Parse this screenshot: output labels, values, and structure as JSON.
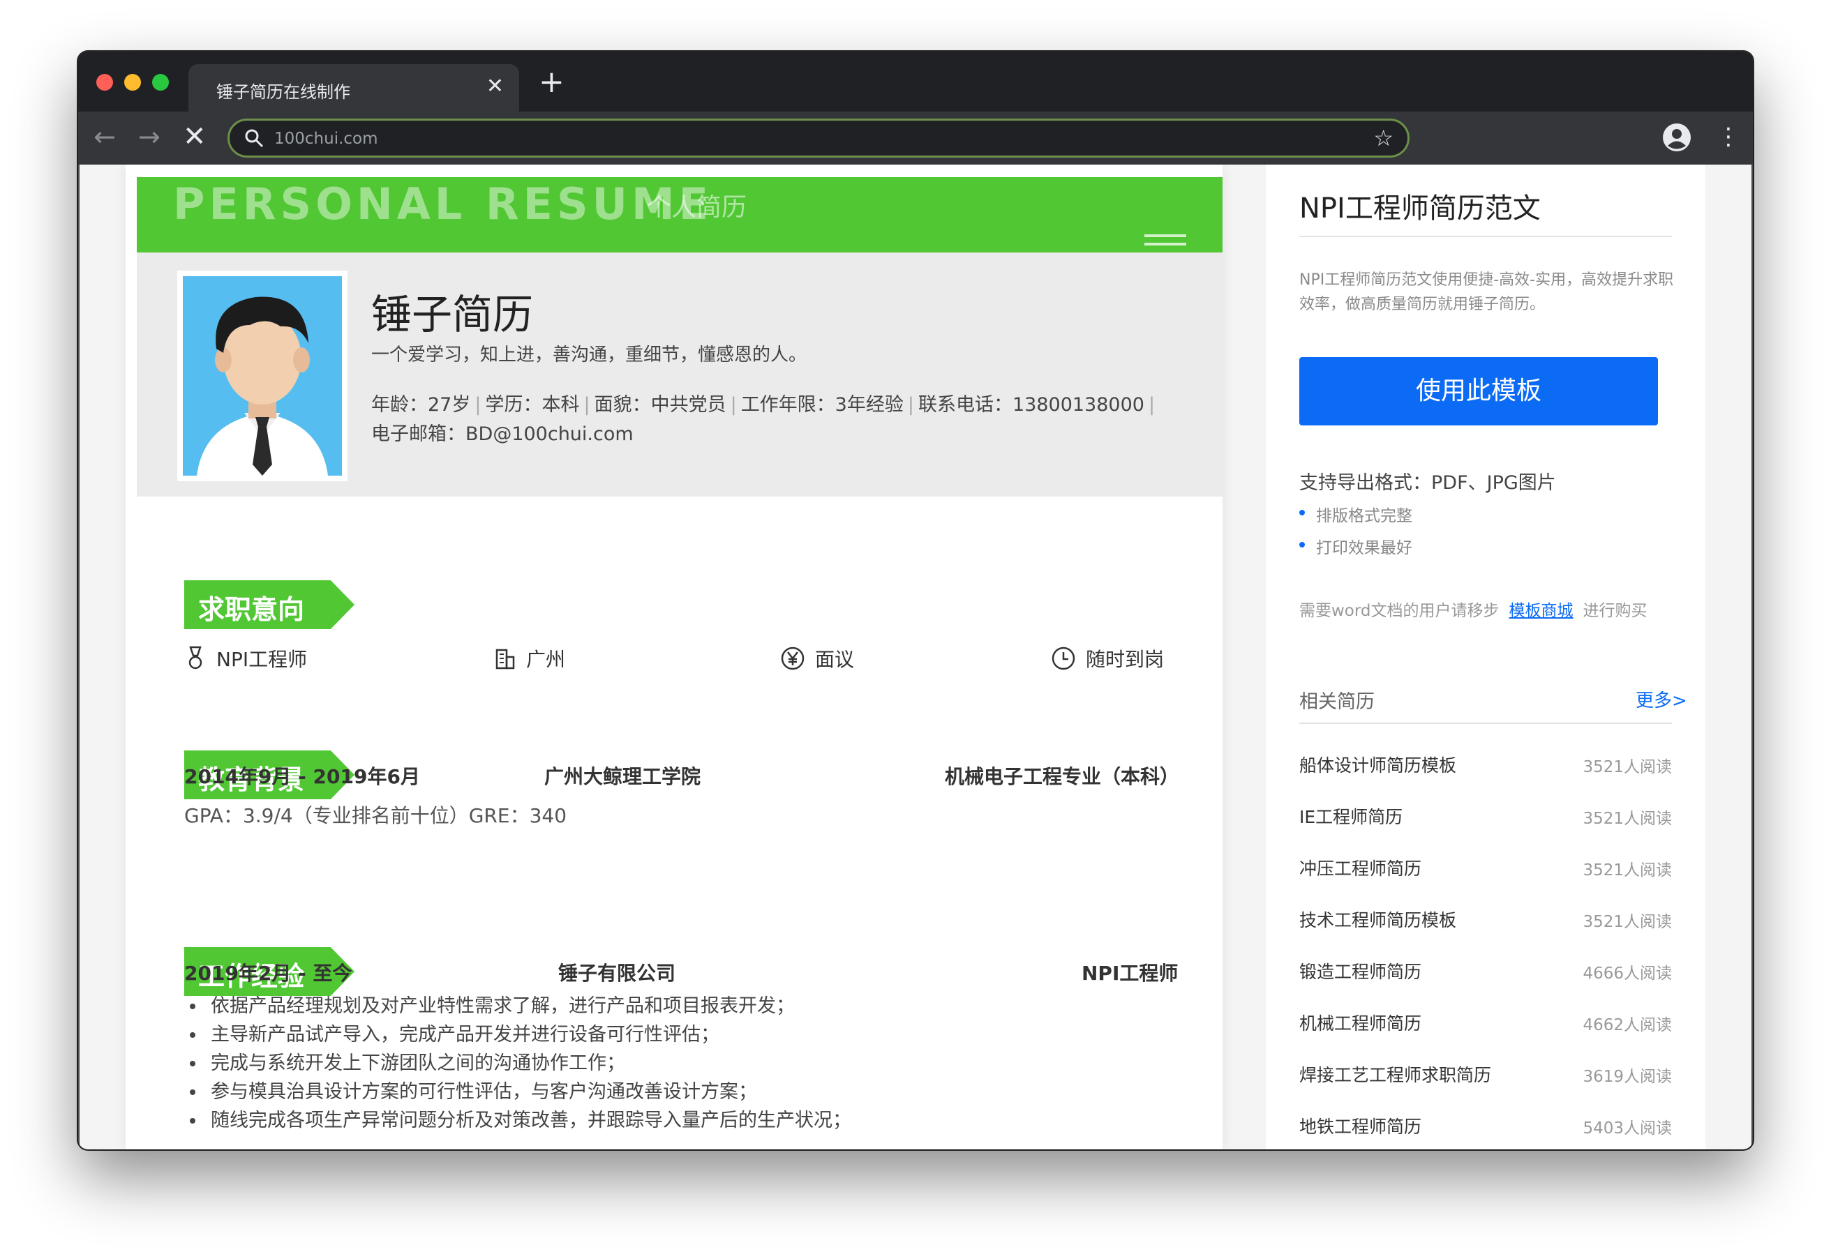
{
  "browser": {
    "tab_title": "锤子简历在线制作",
    "tab_close": "✕",
    "new_tab": "+",
    "url": "100chui.com",
    "back": "←",
    "forward": "→",
    "stop": "✕",
    "star": "☆",
    "menu": "⋮"
  },
  "resume": {
    "banner_title": "PERSONAL RESUME",
    "banner_subtitle": "个人简历",
    "name": "锤子简历",
    "motto": "一个爱学习，知上进，善沟通，重细节，懂感恩的人。",
    "info": {
      "age": "年龄：27岁",
      "education": "学历：本科",
      "politics": "面貌：中共党员",
      "experience": "工作年限：3年经验",
      "phone": "联系电话：13800138000",
      "email": "电子邮箱：BD@100chui.com",
      "separator": "|"
    },
    "sections": {
      "intent": "求职意向",
      "education": "教育背景",
      "work": "工作经验"
    },
    "intent": {
      "position": "NPI工程师",
      "city": "广州",
      "salary": "面议",
      "availability": "随时到岗"
    },
    "education": {
      "period": "2014年9月 - 2019年6月",
      "school": "广州大鲸理工学院",
      "major": "机械电子工程专业（本科）",
      "gpa": "GPA：3.9/4（专业排名前十位）GRE：340"
    },
    "work": {
      "period": "2019年2月 - 至今",
      "company": "锤子有限公司",
      "title": "NPI工程师",
      "bullets": [
        "依据产品经理规划及对产业特性需求了解，进行产品和项目报表开发；",
        "主导新产品试产导入，完成产品开发并进行设备可行性评估；",
        "完成与系统开发上下游团队之间的沟通协作工作；",
        "参与模具治具设计方案的可行性评估，与客户沟通改善设计方案；",
        "随线完成各项生产异常问题分析及对策改善，并跟踪导入量产后的生产状况；"
      ]
    }
  },
  "sidebar": {
    "title": "NPI工程师简历范文",
    "desc": "NPI工程师简历范文使用便捷-高效-实用，高效提升求职效率，做高质量简历就用锤子简历。",
    "use_button": "使用此模板",
    "formats": "支持导出格式：PDF、JPG图片",
    "features": [
      "排版格式完整",
      "打印效果最好"
    ],
    "word_prefix": "需要word文档的用户请移步",
    "word_link": "模板商城",
    "word_suffix": "进行购买",
    "related_title": "相关简历",
    "more": "更多>",
    "related": [
      {
        "name": "船体设计师简历模板",
        "count": "3521人阅读"
      },
      {
        "name": "IE工程师简历",
        "count": "3521人阅读"
      },
      {
        "name": "冲压工程师简历",
        "count": "3521人阅读"
      },
      {
        "name": "技术工程师简历模板",
        "count": "3521人阅读"
      },
      {
        "name": "锻造工程师简历",
        "count": "4666人阅读"
      },
      {
        "name": "机械工程师简历",
        "count": "4662人阅读"
      },
      {
        "name": "焊接工艺工程师求职简历",
        "count": "3619人阅读"
      },
      {
        "name": "地铁工程师简历",
        "count": "5403人阅读"
      }
    ]
  },
  "colors": {
    "accent_green": "#51c734",
    "button_blue": "#0c6bf5"
  }
}
